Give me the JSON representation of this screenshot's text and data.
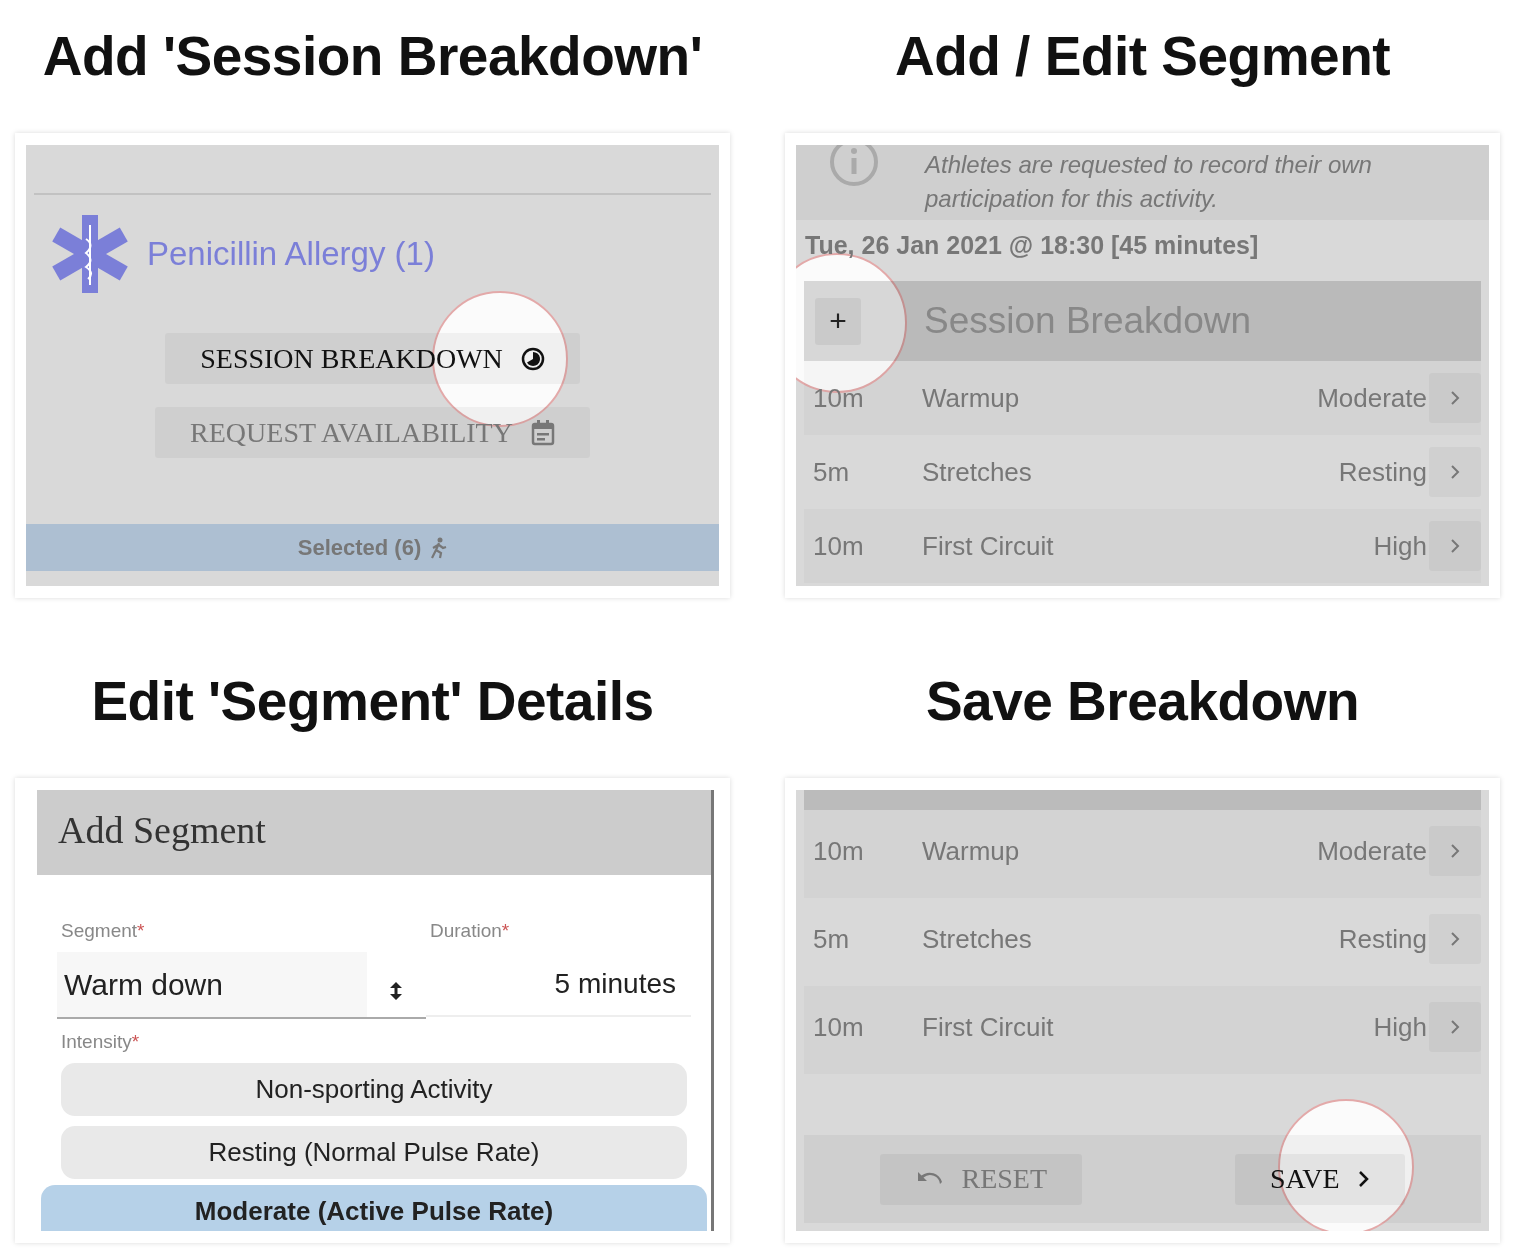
{
  "steps": [
    {
      "kind": "launch",
      "heading": "Add 'Session Breakdown'",
      "alert": "Penicillin Allergy (1)",
      "buttons": [
        {
          "kind": "breakdown",
          "label": "SESSION BREAKDOWN",
          "spotlight": true
        },
        {
          "kind": "availability",
          "label": "REQUEST AVAILABILITY",
          "spotlight": false
        }
      ],
      "footer": "Selected (6)"
    },
    {
      "kind": "list",
      "heading": "Add / Edit Segment",
      "notice": "Athletes are requested to record their own participation for this activity.",
      "date": "Tue, 26 Jan 2021 @ 18:30 [45 minutes]",
      "section": {
        "add": "+",
        "title": "Session Breakdown",
        "spotlight": true
      },
      "rows": [
        {
          "duration": "10m",
          "name": "Warmup",
          "intensity": "Moderate"
        },
        {
          "duration": "5m",
          "name": "Stretches",
          "intensity": "Resting"
        },
        {
          "duration": "10m",
          "name": "First Circuit",
          "intensity": "High"
        }
      ]
    },
    {
      "kind": "dialog",
      "heading": "Edit 'Segment' Details",
      "dialog": {
        "title": "Add Segment",
        "fields": [
          {
            "kind": "select",
            "label": "Segment",
            "marker": "*",
            "value": "Warm down"
          },
          {
            "kind": "text",
            "label": "Duration",
            "marker": "*",
            "value": "5 minutes"
          }
        ],
        "intensity": {
          "label": "Intensity",
          "marker": "*",
          "options": [
            {
              "label": "Non-sporting Activity",
              "selected": false
            },
            {
              "label": "Resting (Normal Pulse Rate)",
              "selected": false
            },
            {
              "label": "Moderate (Active Pulse Rate)",
              "selected": true
            }
          ]
        }
      }
    },
    {
      "kind": "save",
      "heading": "Save Breakdown",
      "rows": [
        {
          "duration": "10m",
          "name": "Warmup",
          "intensity": "Moderate"
        },
        {
          "duration": "5m",
          "name": "Stretches",
          "intensity": "Resting"
        },
        {
          "duration": "10m",
          "name": "First Circuit",
          "intensity": "High"
        }
      ],
      "buttons": [
        {
          "kind": "reset",
          "label": "RESET",
          "spotlight": false
        },
        {
          "kind": "save",
          "label": "SAVE",
          "spotlight": true
        }
      ]
    }
  ]
}
